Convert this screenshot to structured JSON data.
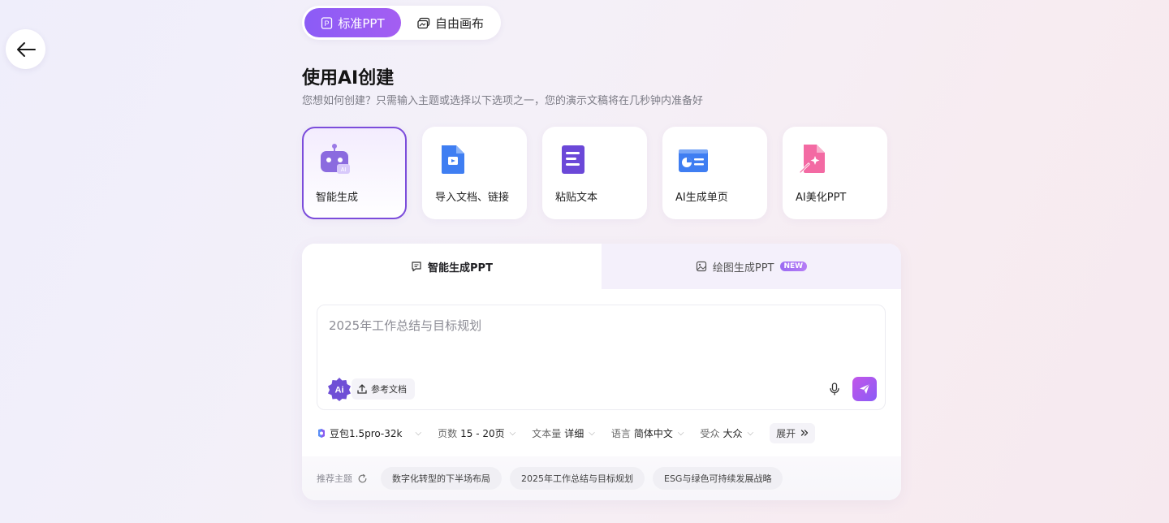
{
  "mode_switch": {
    "standard_label": "标准PPT",
    "free_label": "自由画布"
  },
  "header": {
    "title": "使用AI创建",
    "subtitle": "您想如何创建？只需输入主题或选择以下选项之一，您的演示文稿将在几秒钟内准备好"
  },
  "cards": [
    {
      "label": "智能生成",
      "icon": "robot-icon"
    },
    {
      "label": "导入文档、链接",
      "icon": "import-doc-icon"
    },
    {
      "label": "粘贴文本",
      "icon": "paste-text-icon"
    },
    {
      "label": "AI生成单页",
      "icon": "single-page-icon"
    },
    {
      "label": "AI美化PPT",
      "icon": "beautify-icon"
    }
  ],
  "tabs": {
    "smart_label": "智能生成PPT",
    "drawing_label": "绘图生成PPT",
    "new_badge": "NEW"
  },
  "input": {
    "value": "2025年工作总结与目标规划",
    "ai_badge": "Ai",
    "ref_doc_label": "参考文档"
  },
  "options": {
    "model": "豆包1.5pro-32k",
    "pages_label": "页数",
    "pages_value": "15 - 20页",
    "text_label": "文本量",
    "text_value": "详细",
    "lang_label": "语言",
    "lang_value": "简体中文",
    "audience_label": "受众",
    "audience_value": "大众",
    "expand_label": "展开"
  },
  "recommend": {
    "label": "推荐主题",
    "topics": [
      "数字化转型的下半场布局",
      "2025年工作总结与目标规划",
      "ESG与绿色可持续发展战略"
    ]
  },
  "colors": {
    "accent": "#8b5cf6",
    "accent_border": "#7c4ddb"
  }
}
